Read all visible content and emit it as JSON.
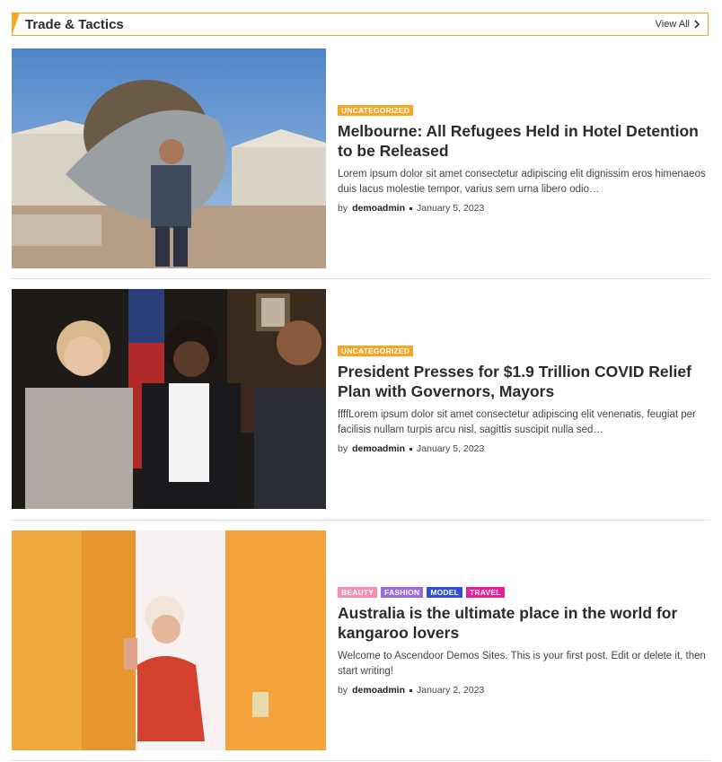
{
  "section": {
    "title": "Trade & Tactics",
    "view_all": "View All",
    "accent_color": "#f5a623"
  },
  "posts": [
    {
      "categories": [
        {
          "label": "UNCATEGORIZED",
          "color": "#f5a623"
        }
      ],
      "title": "Melbourne: All Refugees Held in Hotel Detention to be Released",
      "excerpt": "Lorem ipsum dolor sit amet consectetur adipiscing elit dignissim eros himenaeos duis lacus molestie tempor, varius sem urna libero odio…",
      "by": "by",
      "author": "demoadmin",
      "date": "January 5, 2023",
      "image": "refugee-child-carrying-tarp-photo"
    },
    {
      "categories": [
        {
          "label": "UNCATEGORIZED",
          "color": "#f5a623"
        }
      ],
      "title": "President Presses for $1.9 Trillion COVID Relief Plan with Governors, Mayors",
      "excerpt": "ffffLorem ipsum dolor sit amet consectetur adipiscing elit venenatis, feugiat per facilisis nullam turpis arcu nisl, sagittis suscipit nulla sed…",
      "by": "by",
      "author": "demoadmin",
      "date": "January 5, 2023",
      "image": "officials-meeting-photo"
    },
    {
      "categories": [
        {
          "label": "BEAUTY",
          "color": "#f48fb1"
        },
        {
          "label": "FASHION",
          "color": "#9c6ade"
        },
        {
          "label": "MODEL",
          "color": "#2f4fd8"
        },
        {
          "label": "TRAVEL",
          "color": "#e91e9a"
        }
      ],
      "title": "Australia is the ultimate place in the world for kangaroo lovers",
      "excerpt": "Welcome to Ascendoor Demos Sites. This is your first post. Edit or delete it, then start writing!",
      "by": "by",
      "author": "demoadmin",
      "date": "January 2, 2023",
      "image": "woman-in-orange-doorway-photo"
    }
  ]
}
